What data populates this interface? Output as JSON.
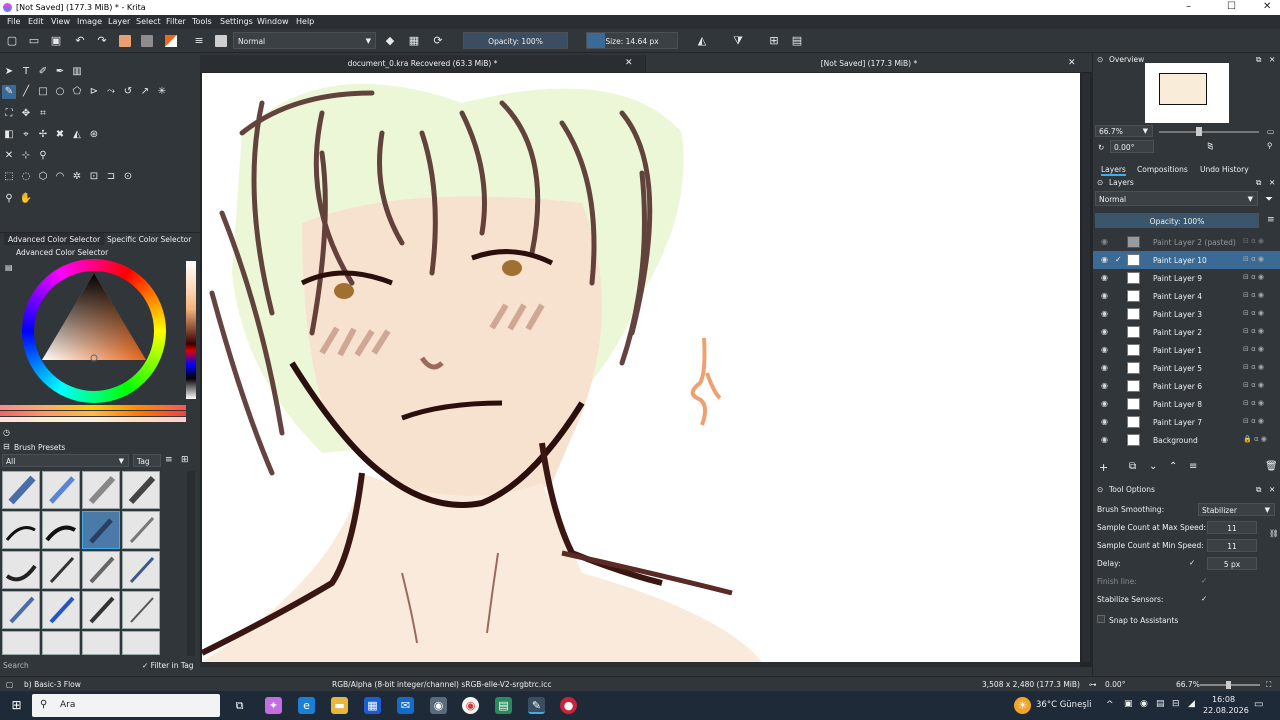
{
  "window": {
    "title": "[Not Saved]  (177.3 MiB) * - Krita",
    "min": "–",
    "max": "☐",
    "close": "✕"
  },
  "menu": [
    "File",
    "Edit",
    "View",
    "Image",
    "Layer",
    "Select",
    "Filter",
    "Tools",
    "Settings",
    "Window",
    "Help"
  ],
  "toolbar": {
    "blend_mode": "Normal",
    "opacity": "Opacity: 100%",
    "size": "Size: 14.64 px"
  },
  "color_panel": {
    "tab1": "Advanced Color Selector",
    "tab2": "Specific Color Selector",
    "title": "Advanced Color Selector"
  },
  "brush_panel": {
    "title": "Brush Presets",
    "filter": "All",
    "tag": "Tag",
    "search": "Search",
    "filter_in_tag": "Filter in Tag"
  },
  "documents": {
    "tab1": "document_0.kra Recovered (63.3 MiB) *",
    "tab2": "[Not Saved]  (177.3 MiB) *"
  },
  "overview": {
    "title": "Overview",
    "zoom": "66.7%",
    "rotation": "0.00°"
  },
  "layers_panel": {
    "tabs": [
      "Layers",
      "Compositions",
      "Undo History"
    ],
    "title": "Layers",
    "blend_mode": "Normal",
    "opacity": "Opacity: 100%",
    "layers": [
      {
        "name": "Paint Layer 2 (pasted)",
        "dim": true
      },
      {
        "name": "Paint Layer 10",
        "active": true
      },
      {
        "name": "Paint Layer 9"
      },
      {
        "name": "Paint Layer 4"
      },
      {
        "name": "Paint Layer 3"
      },
      {
        "name": "Paint Layer 2"
      },
      {
        "name": "Paint Layer 1"
      },
      {
        "name": "Paint Layer 5"
      },
      {
        "name": "Paint Layer 6"
      },
      {
        "name": "Paint Layer 8"
      },
      {
        "name": "Paint Layer 7"
      },
      {
        "name": "Background"
      }
    ]
  },
  "tool_options": {
    "title": "Tool Options",
    "brush_smoothing_label": "Brush Smoothing:",
    "brush_smoothing_value": "Stabilizer",
    "max_speed_label": "Sample Count at Max Speed:",
    "max_speed_value": "11",
    "min_speed_label": "Sample Count at Min Speed:",
    "min_speed_value": "11",
    "delay_label": "Delay:",
    "delay_value": "5 px",
    "finish_line_label": "Finish line:",
    "stabilize_sensors_label": "Stabilize Sensors:",
    "snap_label": "Snap to Assistants"
  },
  "status": {
    "brush": "b) Basic-3 Flow",
    "color_profile": "RGB/Alpha (8-bit integer/channel)  sRGB-elle-V2-srgbtrc.icc",
    "dimensions": "3,508 x 2,480 (177.3 MiB)",
    "rotation": "0.00°",
    "zoom": "66.7%"
  },
  "taskbar": {
    "search": "Ara",
    "weather": "36°C  Güneşli",
    "time": "16:08",
    "date": "22.08.2026"
  },
  "colors": {
    "accent": "#3daee9",
    "panel": "#31363b",
    "selected": "#3b6b94",
    "taskbar": "#1f2a38"
  }
}
